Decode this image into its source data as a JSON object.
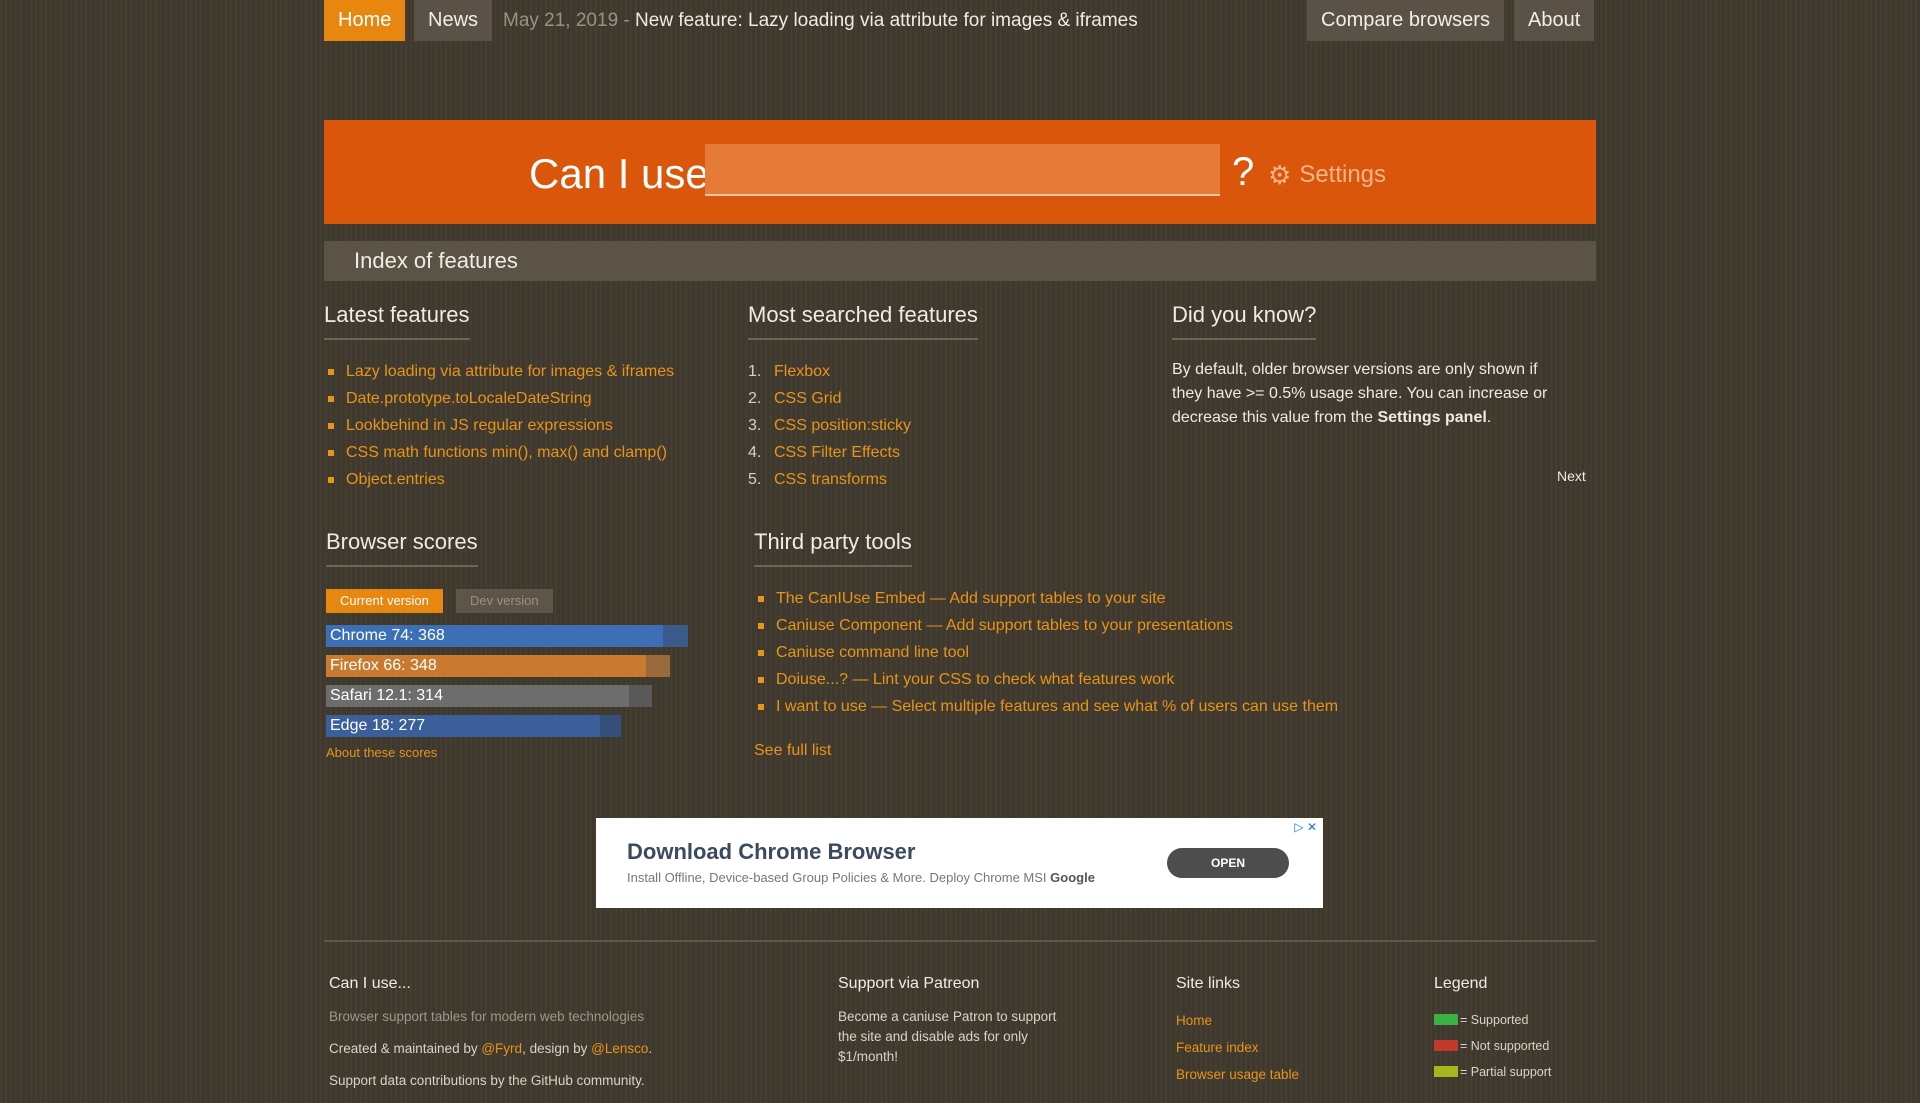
{
  "nav": {
    "home": "Home",
    "news": "News",
    "news_date": "May 21, 2019 -",
    "news_text": "New feature: Lazy loading via attribute for images & iframes",
    "compare": "Compare browsers",
    "about": "About"
  },
  "search": {
    "label": "Can I use",
    "value": "",
    "qmark": "?",
    "settings": "Settings"
  },
  "index_title": "Index of features",
  "latest": {
    "title": "Latest features",
    "items": [
      "Lazy loading via attribute for images & iframes",
      "Date.prototype.toLocaleDateString",
      "Lookbehind in JS regular expressions",
      "CSS math functions min(), max() and clamp()",
      "Object.entries"
    ]
  },
  "most_searched": {
    "title": "Most searched features",
    "items": [
      {
        "n": "1.",
        "label": "Flexbox"
      },
      {
        "n": "2.",
        "label": "CSS Grid"
      },
      {
        "n": "3.",
        "label": "CSS position:sticky"
      },
      {
        "n": "4.",
        "label": "CSS Filter Effects"
      },
      {
        "n": "5.",
        "label": "CSS transforms"
      }
    ]
  },
  "did_you_know": {
    "title": "Did you know?",
    "text_before": "By default, older browser versions are only shown if they have >= 0.5% usage share. You can increase or decrease this value from the ",
    "text_bold": "Settings panel",
    "text_after": ".",
    "next": "Next"
  },
  "browser_scores": {
    "title": "Browser scores",
    "tab_current": "Current version",
    "tab_dev": "Dev version",
    "max_score": 400,
    "bars": [
      {
        "label": "Chrome 74: 368",
        "score": 368,
        "total_share": 1.0,
        "color": "#3d6fb6",
        "tail": "#3a5a8a"
      },
      {
        "label": "Firefox 66: 348",
        "score": 348,
        "total_share": 0.95,
        "color": "#c97a2e",
        "tail": "#9a6a3c"
      },
      {
        "label": "Safari 12.1: 314",
        "score": 314,
        "total_share": 0.9,
        "color": "#6d6d6d",
        "tail": "#595959"
      },
      {
        "label": "Edge 18: 277",
        "score": 277,
        "total_share": 0.815,
        "color": "#3a5f9a",
        "tail": "#34507a"
      }
    ],
    "about": "About these scores"
  },
  "third_party": {
    "title": "Third party tools",
    "items": [
      "The CanIUse Embed — Add support tables to your site",
      "Caniuse Component — Add support tables to your presentations",
      "Caniuse command line tool",
      "Doiuse...? — Lint your CSS to check what features work",
      "I want to use — Select multiple features and see what % of users can use them"
    ],
    "see_full": "See full list"
  },
  "ad": {
    "title": "Download Chrome Browser",
    "sub": "Install Offline, Device-based Group Policies & More. Deploy Chrome MSI",
    "brand": "Google",
    "open": "OPEN",
    "icons": "▷ ✕"
  },
  "footer": {
    "caniuse": {
      "title": "Can I use...",
      "desc": "Browser support tables for modern web technologies",
      "created_prefix": "Created & maintained by ",
      "author": "@Fyrd",
      "design_mid": ", design by ",
      "designer": "@Lensco",
      "design_end": ".",
      "contrib": "Support data contributions by the GitHub community."
    },
    "patreon": {
      "title": "Support via Patreon",
      "text": "Become a caniuse Patron to support the site and disable ads for only $1/month!"
    },
    "site_links": {
      "title": "Site links",
      "items": [
        "Home",
        "Feature index",
        "Browser usage table"
      ]
    },
    "legend": {
      "title": "Legend",
      "items": [
        {
          "label": "= Supported",
          "color": "#3bb143"
        },
        {
          "label": "= Not supported",
          "color": "#c0392b"
        },
        {
          "label": "= Partial support",
          "color": "#a8b51c"
        }
      ]
    }
  }
}
